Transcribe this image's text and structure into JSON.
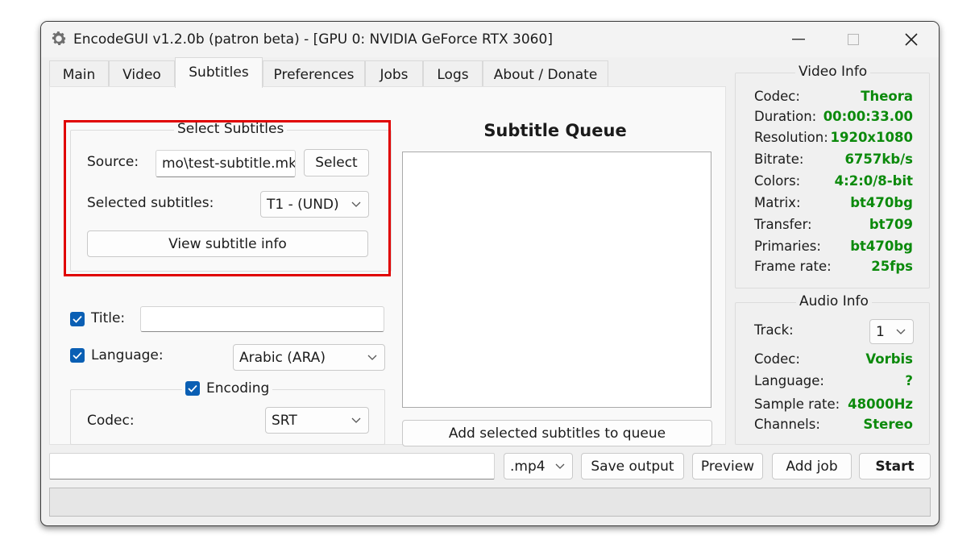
{
  "window": {
    "title": "EncodeGUI v1.2.0b (patron beta) - [GPU 0: NVIDIA GeForce RTX 3060]",
    "controls": {
      "minimize": "—",
      "maximize": "☐",
      "close": "✕"
    }
  },
  "tabs": [
    {
      "label": "Main"
    },
    {
      "label": "Video"
    },
    {
      "label": "Subtitles",
      "active": true
    },
    {
      "label": "Preferences"
    },
    {
      "label": "Jobs"
    },
    {
      "label": "Logs"
    },
    {
      "label": "About / Donate"
    }
  ],
  "select_subtitles": {
    "legend": "Select Subtitles",
    "source_label": "Source:",
    "source_value": "mo\\test-subtitle.mkv",
    "select_button": "Select",
    "selected_label": "Selected subtitles:",
    "selected_value": "T1 - (UND)",
    "view_info_button": "View subtitle info"
  },
  "title_field": {
    "label": "Title:",
    "checked": true,
    "value": ""
  },
  "language_field": {
    "label": "Language:",
    "checked": true,
    "value": "Arabic (ARA)"
  },
  "encoding": {
    "legend": "Encoding",
    "checked": true,
    "codec_label": "Codec:",
    "codec_value": "SRT"
  },
  "queue": {
    "heading": "Subtitle Queue",
    "add_button": "Add selected subtitles to queue"
  },
  "video_info": {
    "legend": "Video Info",
    "rows": [
      {
        "label": "Codec:",
        "value": "Theora"
      },
      {
        "label": "Duration:",
        "value": "00:00:33.00"
      },
      {
        "label": "Resolution:",
        "value": "1920x1080"
      },
      {
        "label": "Bitrate:",
        "value": "6757kb/s"
      },
      {
        "label": "Colors:",
        "value": "4:2:0/8-bit"
      },
      {
        "label": "Matrix:",
        "value": "bt470bg"
      },
      {
        "label": "Transfer:",
        "value": "bt709"
      },
      {
        "label": "Primaries:",
        "value": "bt470bg"
      },
      {
        "label": "Frame rate:",
        "value": "25fps"
      }
    ]
  },
  "audio_info": {
    "legend": "Audio Info",
    "track_label": "Track:",
    "track_value": "1",
    "rows": [
      {
        "label": "Codec:",
        "value": "Vorbis"
      },
      {
        "label": "Language:",
        "value": "?"
      },
      {
        "label": "Sample rate:",
        "value": "48000Hz"
      },
      {
        "label": "Channels:",
        "value": "Stereo"
      }
    ]
  },
  "bottom_bar": {
    "output_path": "",
    "container_value": ".mp4",
    "save_output": "Save output",
    "preview": "Preview",
    "add_job": "Add job",
    "start": "Start"
  },
  "colors": {
    "accent_blue": "#0a5fb4",
    "info_green": "#0c8a0c",
    "highlight_red": "#e00000"
  },
  "icons": {
    "app": "gear-icon",
    "checkbox": "checkmark-icon",
    "dropdown": "chevron-down-icon"
  }
}
